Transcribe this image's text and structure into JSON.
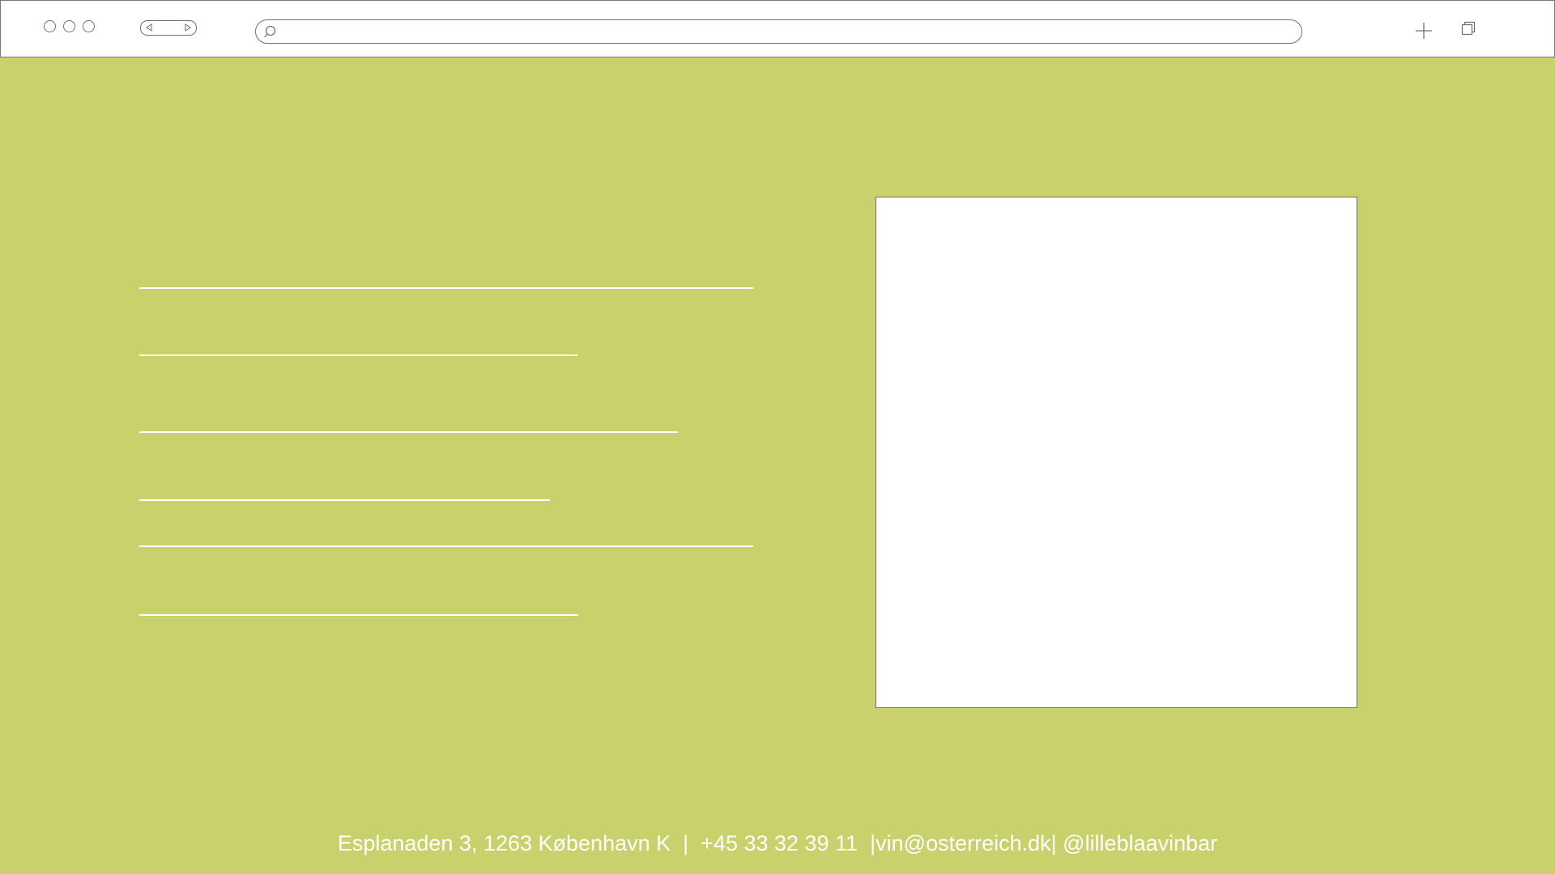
{
  "browser": {
    "traffic_lights": [
      "close",
      "minimize",
      "zoom"
    ],
    "url": "",
    "icons": {
      "back": "back-arrow-icon",
      "forward": "forward-arrow-icon",
      "search": "search-icon",
      "new_tab": "plus-icon",
      "tabs": "tabs-icon"
    }
  },
  "page": {
    "background_color": "#c8d16b",
    "placeholder_line_color": "#ffffff",
    "image_placeholder_color": "#ffffff"
  },
  "footer": {
    "address": "Esplanaden 3, 1263 København K",
    "separator1": "  |  ",
    "phone": "+45 33 32 39 11",
    "separator2": "  |",
    "email": "vin@osterreich.dk",
    "separator3": "| ",
    "social": "@lilleblaavinbar"
  }
}
